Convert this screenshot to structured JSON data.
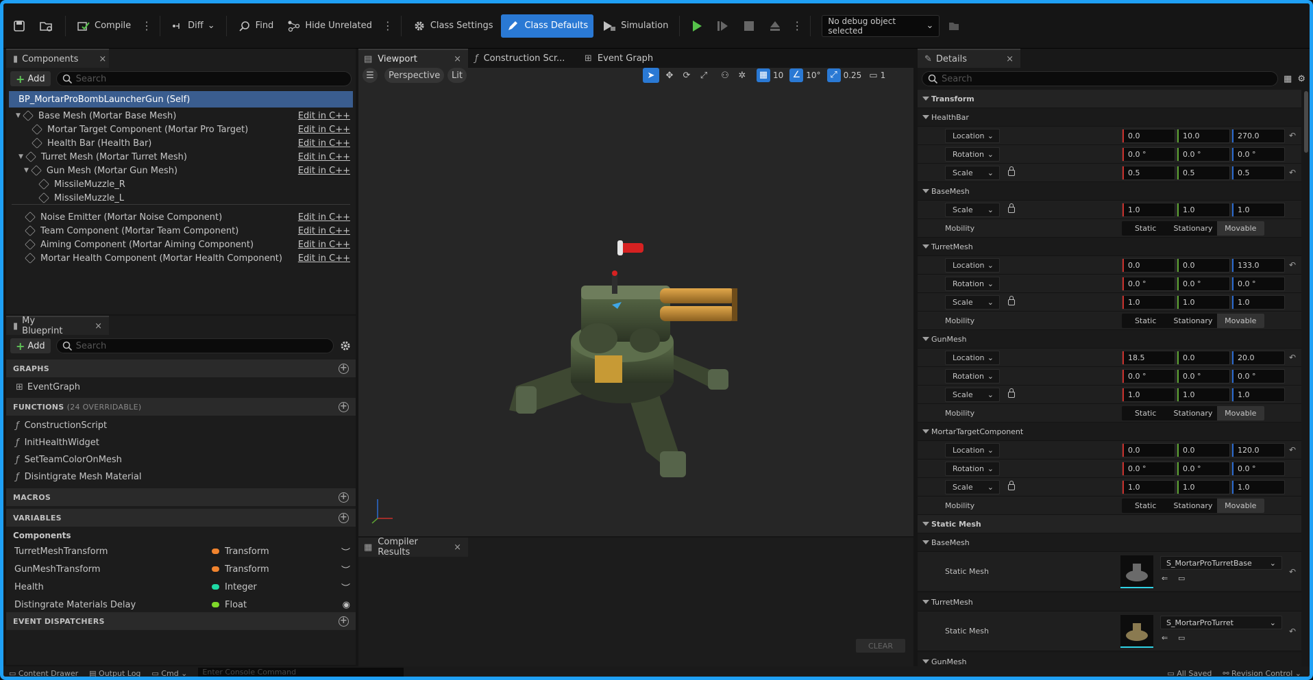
{
  "toolbar": {
    "compile": "Compile",
    "diff": "Diff",
    "find": "Find",
    "hide_unrelated": "Hide Unrelated",
    "class_settings": "Class Settings",
    "class_defaults": "Class Defaults",
    "simulation": "Simulation",
    "debug_object": "No debug object selected"
  },
  "components": {
    "tab": "Components",
    "add": "Add",
    "search_placeholder": "Search",
    "root": "BP_MortarProBombLauncherGun (Self)",
    "edit_label": "Edit in C++",
    "items": [
      {
        "label": "Base Mesh (Mortar Base Mesh)",
        "edit": true
      },
      {
        "label": "Mortar Target Component (Mortar Pro Target)",
        "edit": true
      },
      {
        "label": "Health Bar (Health Bar)",
        "edit": true
      },
      {
        "label": "Turret Mesh (Mortar Turret Mesh)",
        "edit": true
      },
      {
        "label": "Gun Mesh (Mortar Gun Mesh)",
        "edit": true
      },
      {
        "label": "MissileMuzzle_R",
        "edit": false
      },
      {
        "label": "MissileMuzzle_L",
        "edit": false
      },
      {
        "label": "Noise Emitter (Mortar Noise Component)",
        "edit": true
      },
      {
        "label": "Team Component (Mortar Team Component)",
        "edit": true
      },
      {
        "label": "Aiming Component (Mortar Aiming Component)",
        "edit": true
      },
      {
        "label": "Mortar Health Component (Mortar Health Component)",
        "edit": true
      }
    ]
  },
  "blueprint": {
    "tab": "My Blueprint",
    "add": "Add",
    "search_placeholder": "Search",
    "graphs_header": "GRAPHS",
    "event_graph": "EventGraph",
    "functions_header": "FUNCTIONS",
    "functions_count": "(24 OVERRIDABLE)",
    "functions": [
      "ConstructionScript",
      "InitHealthWidget",
      "SetTeamColorOnMesh",
      "Disintigrate Mesh Material"
    ],
    "macros_header": "MACROS",
    "variables_header": "VARIABLES",
    "components_sub": "Components",
    "variables": [
      {
        "name": "TurretMeshTransform",
        "type": "Transform",
        "color": "#f0832e"
      },
      {
        "name": "GunMeshTransform",
        "type": "Transform",
        "color": "#f0832e"
      },
      {
        "name": "Health",
        "type": "Integer",
        "color": "#1ed9a4"
      },
      {
        "name": "Distingrate Materials Delay",
        "type": "Float",
        "color": "#7fd82a"
      }
    ],
    "dispatchers_header": "EVENT DISPATCHERS"
  },
  "tabs": {
    "viewport": "Viewport",
    "construction": "Construction Scr...",
    "event_graph": "Event Graph"
  },
  "viewport": {
    "perspective": "Perspective",
    "lit": "Lit",
    "grid_snap": "10",
    "angle_snap": "10°",
    "scale_snap": "0.25",
    "camera_speed": "1"
  },
  "compiler": {
    "tab": "Compiler Results",
    "clear": "CLEAR"
  },
  "details": {
    "tab": "Details",
    "search_placeholder": "Search",
    "transform_header": "Transform",
    "static_mesh_header": "Static Mesh",
    "mobility_label": "Mobility",
    "mobility_opts": [
      "Static",
      "Stationary",
      "Movable"
    ],
    "location": "Location",
    "rotation": "Rotation",
    "scale": "Scale",
    "static_mesh_label": "Static Mesh",
    "healthbar": {
      "name": "HealthBar",
      "loc": [
        "0.0",
        "10.0",
        "270.0"
      ],
      "rot": [
        "0.0 °",
        "0.0 °",
        "0.0 °"
      ],
      "scale": [
        "0.5",
        "0.5",
        "0.5"
      ]
    },
    "basemesh": {
      "name": "BaseMesh",
      "scale": [
        "1.0",
        "1.0",
        "1.0"
      ]
    },
    "turretmesh": {
      "name": "TurretMesh",
      "loc": [
        "0.0",
        "0.0",
        "133.0"
      ],
      "rot": [
        "0.0 °",
        "0.0 °",
        "0.0 °"
      ],
      "scale": [
        "1.0",
        "1.0",
        "1.0"
      ]
    },
    "gunmesh": {
      "name": "GunMesh",
      "loc": [
        "18.5",
        "0.0",
        "20.0"
      ],
      "rot": [
        "0.0 °",
        "0.0 °",
        "0.0 °"
      ],
      "scale": [
        "1.0",
        "1.0",
        "1.0"
      ]
    },
    "target": {
      "name": "MortarTargetComponent",
      "loc": [
        "0.0",
        "0.0",
        "120.0"
      ],
      "rot": [
        "0.0 °",
        "0.0 °",
        "0.0 °"
      ],
      "scale": [
        "1.0",
        "1.0",
        "1.0"
      ]
    },
    "sm_base": {
      "name": "BaseMesh",
      "asset": "S_MortarProTurretBase"
    },
    "sm_turret": {
      "name": "TurretMesh",
      "asset": "S_MortarProTurret"
    },
    "sm_gun": {
      "name": "GunMesh"
    }
  },
  "status": {
    "content_drawer": "Content Drawer",
    "output_log": "Output Log",
    "cmd": "Cmd",
    "console_placeholder": "Enter Console Command",
    "all_saved": "All Saved",
    "revision_control": "Revision Control"
  }
}
